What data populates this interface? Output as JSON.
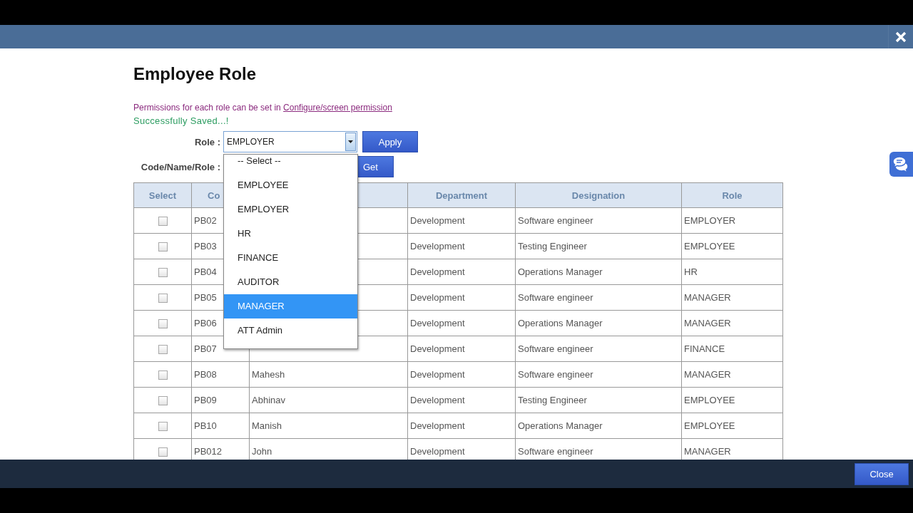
{
  "title": "Employee Role",
  "permission_note": {
    "text": "Permissions for each role can be set in",
    "link": "Configure/screen permission"
  },
  "status_message": "Successfully Saved...!",
  "role_filter": {
    "label": "Role :",
    "value": "EMPLOYER",
    "button": "Apply",
    "expanded": true
  },
  "search": {
    "label": "Code/Name/Role :",
    "button": "Get"
  },
  "role_options": [
    {
      "label": "-- Select --",
      "selected": false
    },
    {
      "label": "EMPLOYEE",
      "selected": false
    },
    {
      "label": "EMPLOYER",
      "selected": false
    },
    {
      "label": "HR",
      "selected": false
    },
    {
      "label": "FINANCE",
      "selected": false
    },
    {
      "label": "AUDITOR",
      "selected": false
    },
    {
      "label": "MANAGER",
      "selected": true
    },
    {
      "label": "ATT Admin",
      "selected": false
    }
  ],
  "table": {
    "columns": [
      {
        "label": "Select"
      },
      {
        "label": "Co"
      },
      {},
      {
        "label": "Department"
      },
      {
        "label": "Designation"
      },
      {
        "label": "Role"
      }
    ],
    "rows": [
      {
        "checked": false,
        "code": "PB02",
        "name": null,
        "department": "Development",
        "designation": "Software engineer",
        "role": "EMPLOYER"
      },
      {
        "checked": false,
        "code": "PB03",
        "name": null,
        "department": "Development",
        "designation": "Testing Engineer",
        "role": "EMPLOYEE"
      },
      {
        "checked": false,
        "code": "PB04",
        "name": null,
        "department": "Development",
        "designation": "Operations Manager",
        "role": "HR"
      },
      {
        "checked": false,
        "code": "PB05",
        "name": null,
        "department": "Development",
        "designation": "Software engineer",
        "role": "MANAGER"
      },
      {
        "checked": false,
        "code": "PB06",
        "name": null,
        "department": "Development",
        "designation": "Operations Manager",
        "role": "MANAGER"
      },
      {
        "checked": false,
        "code": "PB07",
        "name": null,
        "department": "Development",
        "designation": "Software engineer",
        "role": "FINANCE"
      },
      {
        "checked": false,
        "code": "PB08",
        "name": "Mahesh",
        "department": "Development",
        "designation": "Software engineer",
        "role": "MANAGER"
      },
      {
        "checked": false,
        "code": "PB09",
        "name": "Abhinav",
        "department": "Development",
        "designation": "Testing Engineer",
        "role": "EMPLOYEE"
      },
      {
        "checked": false,
        "code": "PB10",
        "name": "Manish",
        "department": "Development",
        "designation": "Operations Manager",
        "role": "EMPLOYEE"
      },
      {
        "checked": false,
        "code": "PB012",
        "name": "John",
        "department": "Development",
        "designation": "Software engineer",
        "role": "MANAGER"
      }
    ]
  },
  "footer": {
    "button": "Close"
  }
}
